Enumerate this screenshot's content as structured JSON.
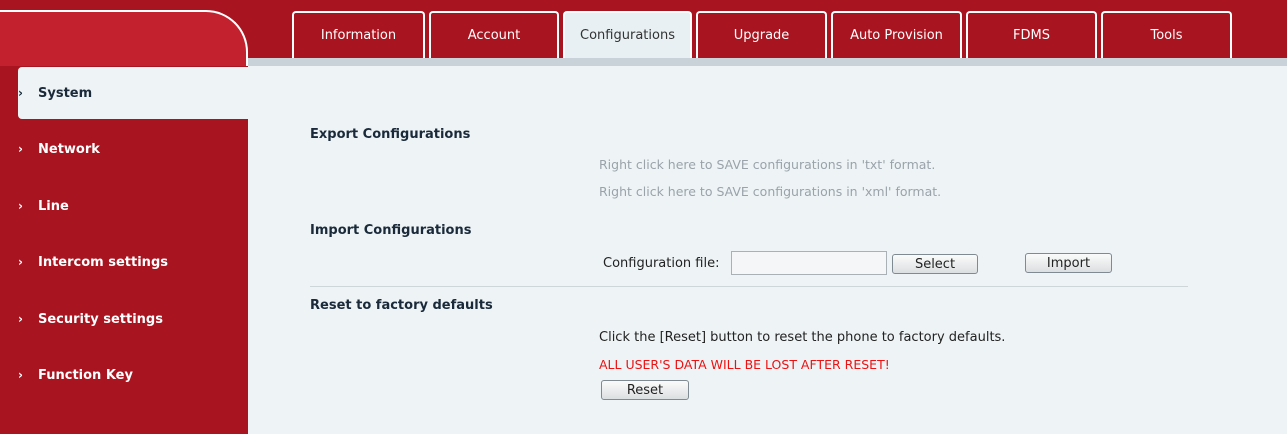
{
  "tabs": [
    {
      "label": "Information",
      "active": false
    },
    {
      "label": "Account",
      "active": false
    },
    {
      "label": "Configurations",
      "active": true
    },
    {
      "label": "Upgrade",
      "active": false
    },
    {
      "label": "Auto Provision",
      "active": false
    },
    {
      "label": "FDMS",
      "active": false
    },
    {
      "label": "Tools",
      "active": false
    }
  ],
  "sidebar": {
    "chevron": "›",
    "items": [
      {
        "label": "System",
        "active": true
      },
      {
        "label": "Network",
        "active": false
      },
      {
        "label": "Line",
        "active": false
      },
      {
        "label": "Intercom settings",
        "active": false
      },
      {
        "label": "Security settings",
        "active": false
      },
      {
        "label": "Function Key",
        "active": false
      }
    ]
  },
  "export": {
    "title": "Export Configurations",
    "txt_link": "Right click here to SAVE configurations in 'txt' format.",
    "xml_link": "Right click here to SAVE configurations in 'xml' format."
  },
  "import": {
    "title": "Import Configurations",
    "file_label": "Configuration file:",
    "file_value": "",
    "select_label": "Select",
    "import_label": "Import"
  },
  "reset": {
    "title": "Reset to factory defaults",
    "description": "Click the [Reset] button to reset the phone to factory defaults.",
    "warning": "ALL USER'S DATA WILL BE LOST AFTER RESET!",
    "button_label": "Reset"
  },
  "colors": {
    "brand_red": "#a8141f",
    "content_bg": "#eef4f6",
    "warning_red": "#ee1111",
    "link_gray": "#9aa3aa"
  }
}
